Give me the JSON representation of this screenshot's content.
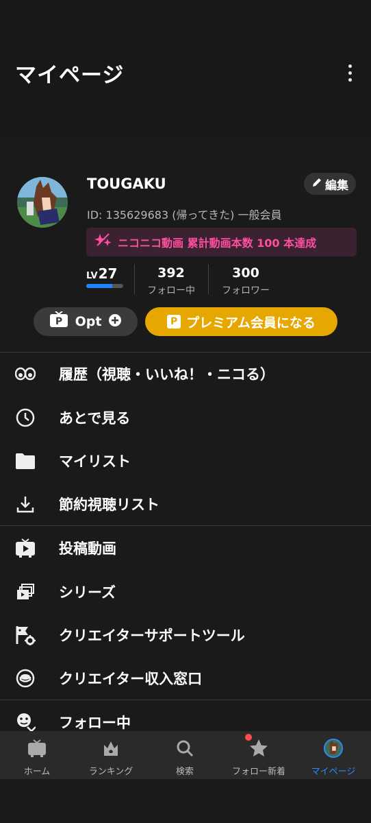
{
  "header": {
    "title": "マイページ"
  },
  "profile": {
    "username": "TOUGAKU",
    "edit_label": "編集",
    "user_id": "ID: 135629683 (帰ってきた) 一般会員",
    "achievement": "ニコニコ動画 累計動画本数 100 本達成",
    "level_prefix": "LV",
    "level": "27",
    "level_progress": 0.7,
    "following_count": "392",
    "following_label": "フォロー中",
    "followers_count": "300",
    "followers_label": "フォロワー",
    "opt_label": "Opt",
    "premium_label": "プレミアム会員になる",
    "premium_badge": "P"
  },
  "menu": {
    "items": [
      {
        "label": "履歴（視聴・いいね！・ニコる）",
        "icon": "eyes-icon"
      },
      {
        "label": "あとで見る",
        "icon": "clock-icon"
      },
      {
        "label": "マイリスト",
        "icon": "folder-icon"
      },
      {
        "label": "節約視聴リスト",
        "icon": "download-icon"
      },
      {
        "label": "投稿動画",
        "icon": "tv-play-icon"
      },
      {
        "label": "シリーズ",
        "icon": "series-icon"
      },
      {
        "label": "クリエイターサポートツール",
        "icon": "creator-tools-icon"
      },
      {
        "label": "クリエイター収入窓口",
        "icon": "coin-icon"
      },
      {
        "label": "フォロー中",
        "icon": "follow-icon"
      }
    ]
  },
  "nav": {
    "items": [
      {
        "label": "ホーム",
        "icon": "tv-icon"
      },
      {
        "label": "ランキング",
        "icon": "crown-icon"
      },
      {
        "label": "検索",
        "icon": "search-icon"
      },
      {
        "label": "フォロー新着",
        "icon": "star-icon"
      },
      {
        "label": "マイページ",
        "icon": "avatar-icon"
      }
    ]
  },
  "colors": {
    "accent_blue": "#2a8cff",
    "premium": "#e6a800",
    "achievement_pink": "#ff4fa0",
    "notification_red": "#ff4d4d"
  }
}
